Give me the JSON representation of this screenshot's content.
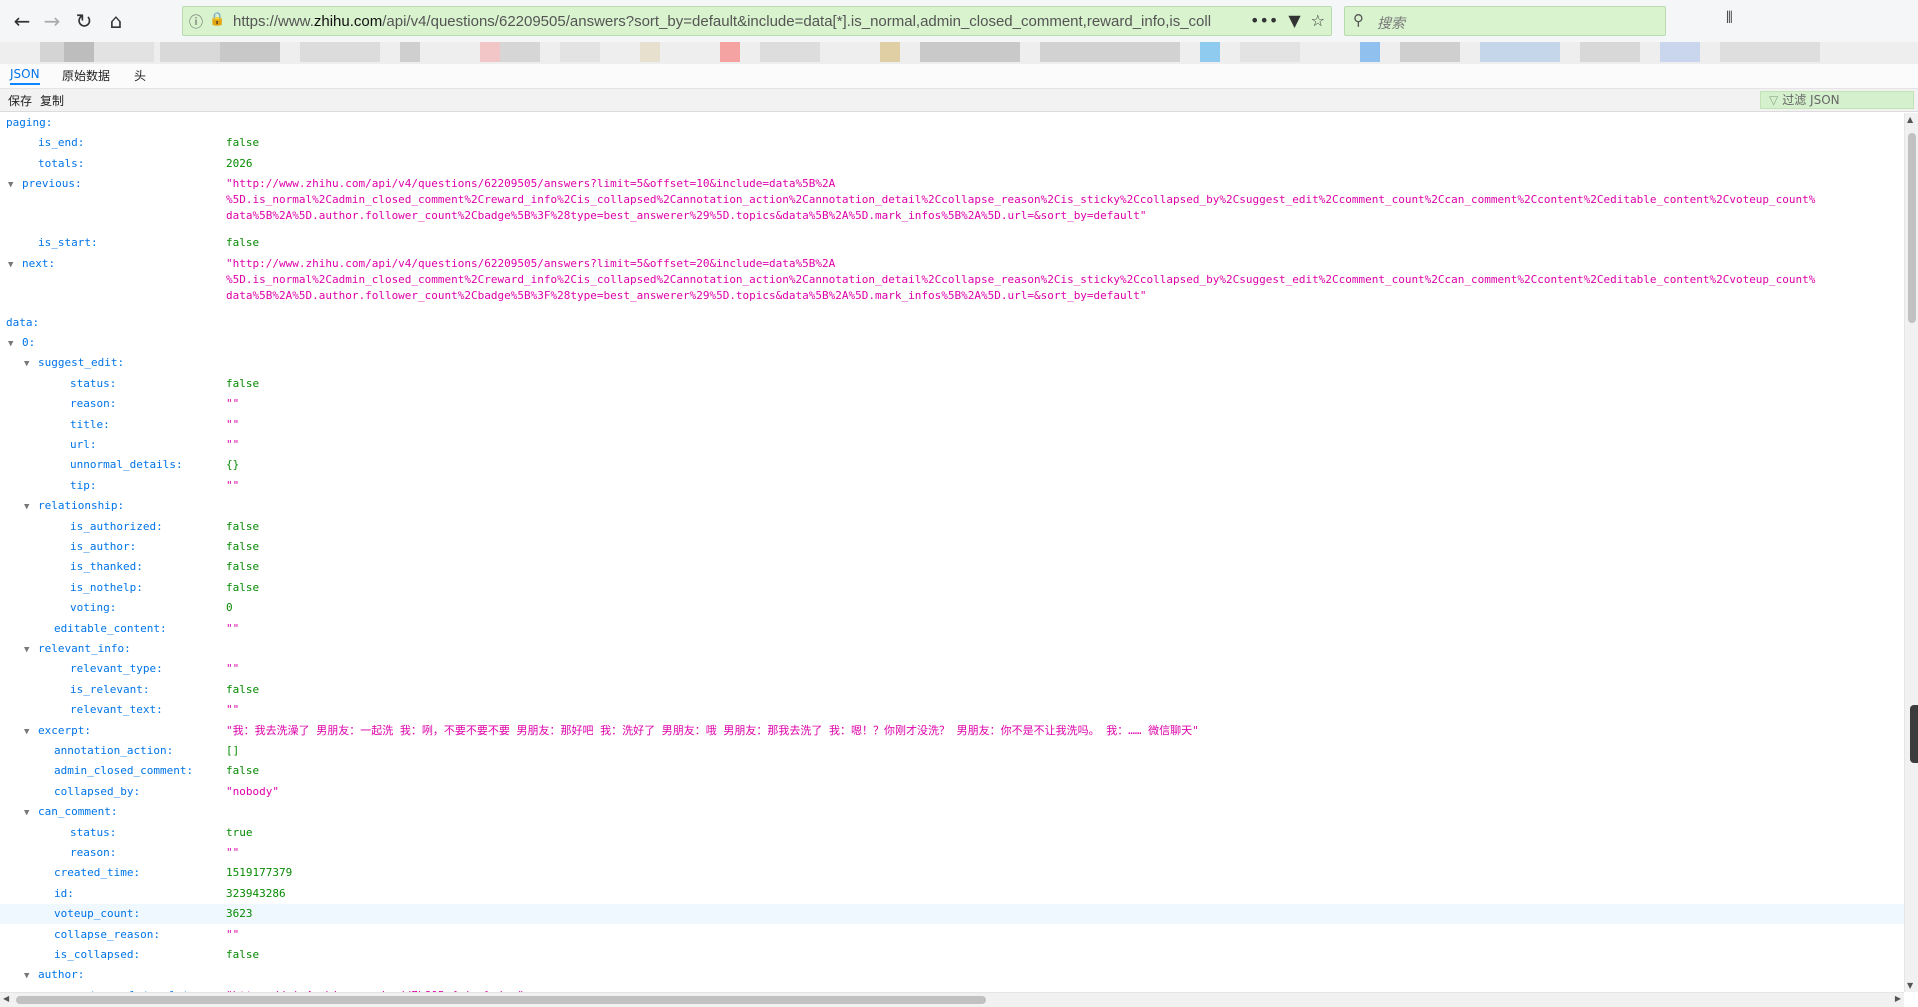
{
  "browser": {
    "url_prefix": "https://www.",
    "url_domain": "zhihu.com",
    "url_rest": "/api/v4/questions/62209505/answers?sort_by=default&include=data[*].is_normal,admin_closed_comment,reward_info,is_coll",
    "search_placeholder": "搜索",
    "back_icon": "←",
    "forward_icon": "→",
    "reload_icon": "↻",
    "home_icon": "⌂",
    "more_icon": "•••",
    "pocket_icon": "▼",
    "star_icon": "☆",
    "info_icon": "ⓘ",
    "lock_icon": "🔒",
    "search_glyph": "⚲",
    "library_icon": "⫴"
  },
  "viewer": {
    "tabs": [
      "JSON",
      "原始数据",
      "头"
    ],
    "save_label": "保存",
    "copy_label": "复制",
    "filter_placeholder": "过滤 JSON"
  },
  "rows": [
    {
      "indent": 0,
      "key": "paging:",
      "expand": true
    },
    {
      "indent": 2,
      "key": "is_end:",
      "value": "false",
      "type": "bool"
    },
    {
      "indent": 2,
      "key": "totals:",
      "value": "2026",
      "type": "num"
    },
    {
      "indent": 1,
      "key": "previous:",
      "expand": true,
      "multiline": [
        "\"http://www.zhihu.com/api/v4/questions/62209505/answers?limit=5&offset=10&include=data%5B%2A",
        "%5D.is_normal%2Cadmin_closed_comment%2Creward_info%2Cis_collapsed%2Cannotation_action%2Cannotation_detail%2Ccollapse_reason%2Cis_sticky%2Ccollapsed_by%2Csuggest_edit%2Ccomment_count%2Ccan_comment%2Ccontent%2Ceditable_content%2Cvoteup_count%",
        "data%5B%2A%5D.author.follower_count%2Cbadge%5B%3F%28type=best_answerer%29%5D.topics&data%5B%2A%5D.mark_infos%5B%2A%5D.url=&sort_by=default\""
      ]
    },
    {
      "indent": 2,
      "key": "is_start:",
      "value": "false",
      "type": "bool"
    },
    {
      "indent": 1,
      "key": "next:",
      "expand": true,
      "multiline": [
        "\"http://www.zhihu.com/api/v4/questions/62209505/answers?limit=5&offset=20&include=data%5B%2A",
        "%5D.is_normal%2Cadmin_closed_comment%2Creward_info%2Cis_collapsed%2Cannotation_action%2Cannotation_detail%2Ccollapse_reason%2Cis_sticky%2Ccollapsed_by%2Csuggest_edit%2Ccomment_count%2Ccan_comment%2Ccontent%2Ceditable_content%2Cvoteup_count%",
        "data%5B%2A%5D.author.follower_count%2Cbadge%5B%3F%28type=best_answerer%29%5D.topics&data%5B%2A%5D.mark_infos%5B%2A%5D.url=&sort_by=default\""
      ]
    },
    {
      "indent": 0,
      "key": "data:",
      "expand": true
    },
    {
      "indent": 1,
      "key": "0:",
      "expand": true
    },
    {
      "indent": 2,
      "key": "suggest_edit:",
      "expand": true
    },
    {
      "indent": 4,
      "key": "status:",
      "value": "false",
      "type": "bool"
    },
    {
      "indent": 4,
      "key": "reason:",
      "value": "\"\"",
      "type": "str"
    },
    {
      "indent": 4,
      "key": "title:",
      "value": "\"\"",
      "type": "str"
    },
    {
      "indent": 4,
      "key": "url:",
      "value": "\"\"",
      "type": "str"
    },
    {
      "indent": 4,
      "key": "unnormal_details:",
      "value": "{}",
      "type": "obj"
    },
    {
      "indent": 4,
      "key": "tip:",
      "value": "\"\"",
      "type": "str"
    },
    {
      "indent": 2,
      "key": "relationship:",
      "expand": true
    },
    {
      "indent": 4,
      "key": "is_authorized:",
      "value": "false",
      "type": "bool"
    },
    {
      "indent": 4,
      "key": "is_author:",
      "value": "false",
      "type": "bool"
    },
    {
      "indent": 4,
      "key": "is_thanked:",
      "value": "false",
      "type": "bool"
    },
    {
      "indent": 4,
      "key": "is_nothelp:",
      "value": "false",
      "type": "bool"
    },
    {
      "indent": 4,
      "key": "voting:",
      "value": "0",
      "type": "num"
    },
    {
      "indent": 3,
      "key": "editable_content:",
      "value": "\"\"",
      "type": "str"
    },
    {
      "indent": 2,
      "key": "relevant_info:",
      "expand": true
    },
    {
      "indent": 4,
      "key": "relevant_type:",
      "value": "\"\"",
      "type": "str"
    },
    {
      "indent": 4,
      "key": "is_relevant:",
      "value": "false",
      "type": "bool"
    },
    {
      "indent": 4,
      "key": "relevant_text:",
      "value": "\"\"",
      "type": "str"
    },
    {
      "indent": 2,
      "key": "excerpt:",
      "expand": true,
      "value": "\"我：我去洗澡了 男朋友：一起洗 我：咧，不要不要不要 男朋友：那好吧 我：洗好了 男朋友：哦 男朋友：那我去洗了 我：嗯！？你刚才没洗？ 男朋友：你不是不让我洗吗。 我：…… 微信聊天\"",
      "type": "str"
    },
    {
      "indent": 3,
      "key": "annotation_action:",
      "value": "[]",
      "type": "obj"
    },
    {
      "indent": 3,
      "key": "admin_closed_comment:",
      "value": "false",
      "type": "bool"
    },
    {
      "indent": 3,
      "key": "collapsed_by:",
      "value": "\"nobody\"",
      "type": "str"
    },
    {
      "indent": 2,
      "key": "can_comment:",
      "expand": true
    },
    {
      "indent": 4,
      "key": "status:",
      "value": "true",
      "type": "bool"
    },
    {
      "indent": 4,
      "key": "reason:",
      "value": "\"\"",
      "type": "str"
    },
    {
      "indent": 3,
      "key": "created_time:",
      "value": "1519177379",
      "type": "num"
    },
    {
      "indent": 3,
      "key": "id:",
      "value": "323943286",
      "type": "num"
    },
    {
      "indent": 3,
      "key": "voteup_count:",
      "value": "3623",
      "type": "num",
      "highlight": true
    },
    {
      "indent": 3,
      "key": "collapse_reason:",
      "value": "\"\"",
      "type": "str"
    },
    {
      "indent": 3,
      "key": "is_collapsed:",
      "value": "false",
      "type": "bool"
    },
    {
      "indent": 2,
      "key": "author:",
      "expand": true
    },
    {
      "indent": 4,
      "key": "avatar_url_template:",
      "value": "\"https://pic4.zhimg.com/aadd7b895_{size}.jpg\"",
      "type": "str"
    },
    {
      "indent": 4,
      "key": "gender:",
      "value": "1",
      "type": "num"
    }
  ],
  "colors": {
    "key": "#0074e8",
    "string": "#dd00a9",
    "number": "#058b00",
    "urlbar": "#d9f3cf"
  }
}
